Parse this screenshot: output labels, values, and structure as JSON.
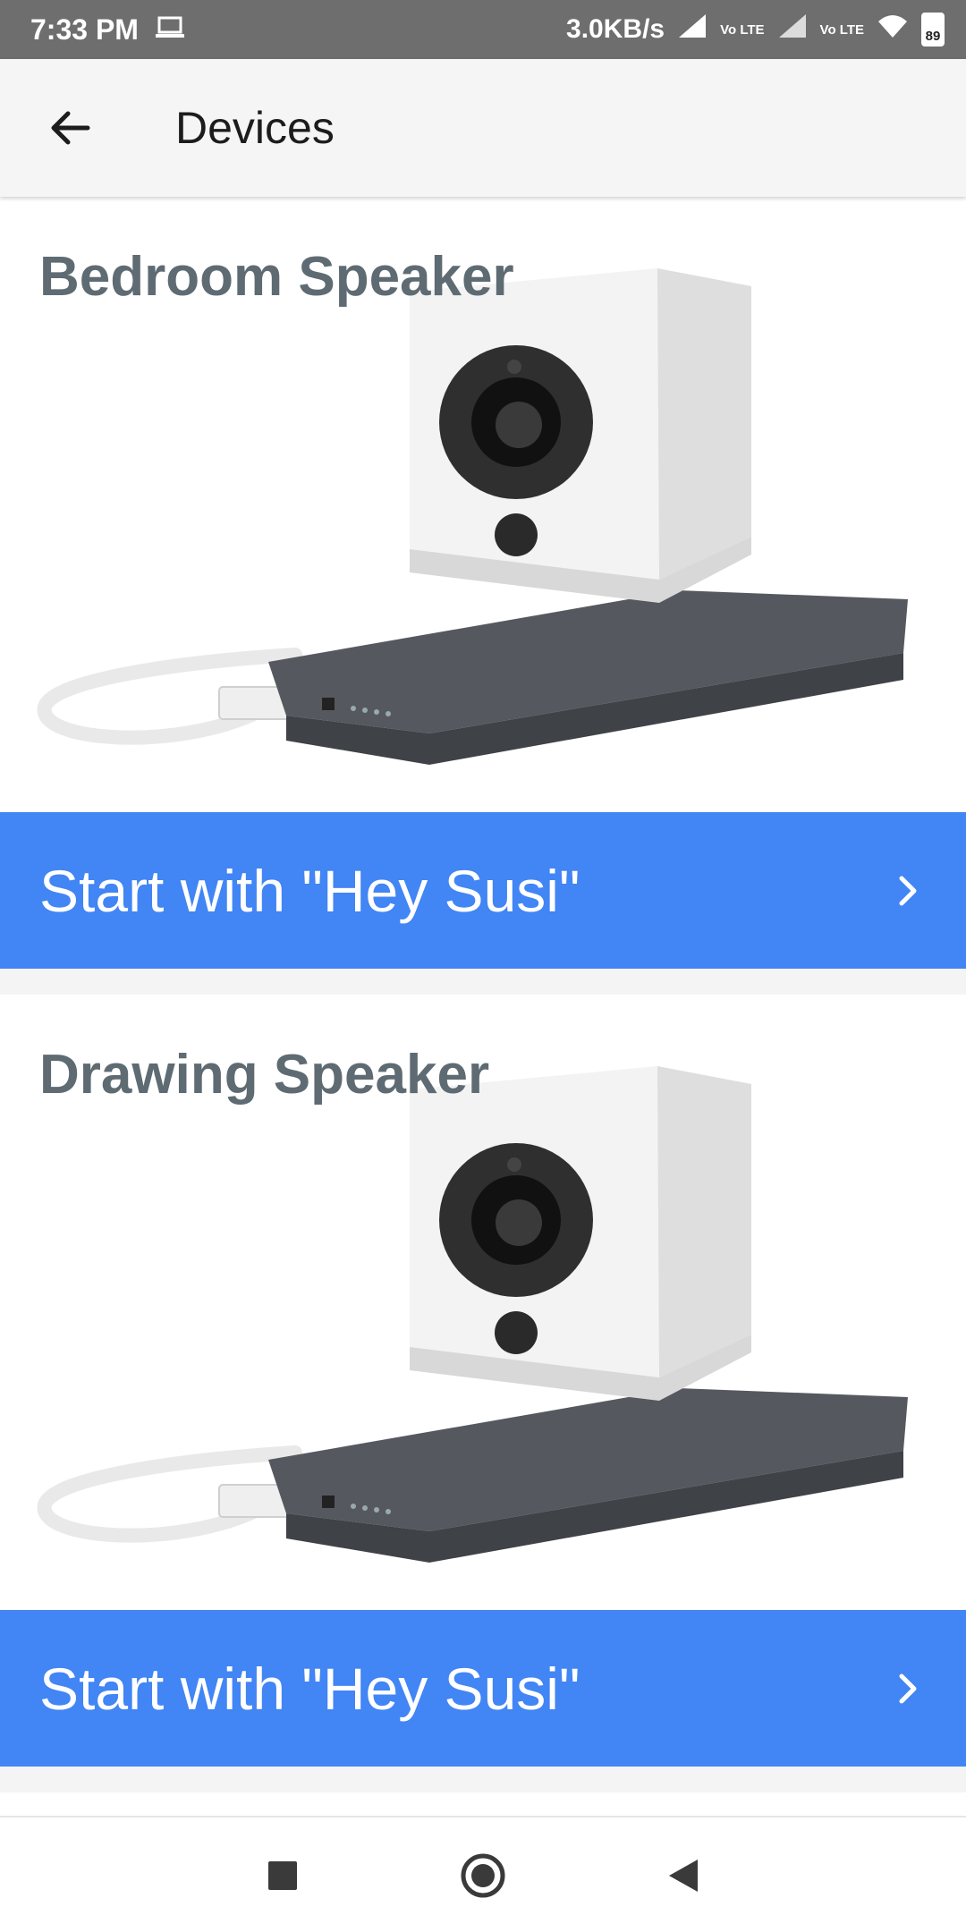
{
  "status_bar": {
    "time": "7:33 PM",
    "net_speed": "3.0KB/s",
    "volte_1": "Vo LTE",
    "volte_2": "Vo LTE",
    "battery": "89",
    "icons": [
      "laptop-icon",
      "signal-icon",
      "wifi-icon",
      "battery-icon"
    ]
  },
  "app_bar": {
    "title": "Devices",
    "back_icon": "arrow-back-icon"
  },
  "devices": [
    {
      "name": "Bedroom Speaker",
      "action_label": "Start with \"Hey Susi\""
    },
    {
      "name": "Drawing Speaker",
      "action_label": "Start with \"Hey Susi\""
    }
  ],
  "nav_bar": {
    "icons": [
      "recents-square-icon",
      "home-circle-icon",
      "back-triangle-icon"
    ]
  },
  "colors": {
    "accent": "#4285f4",
    "title_text": "#5f6b73",
    "status_bar": "#6e6e6e"
  }
}
